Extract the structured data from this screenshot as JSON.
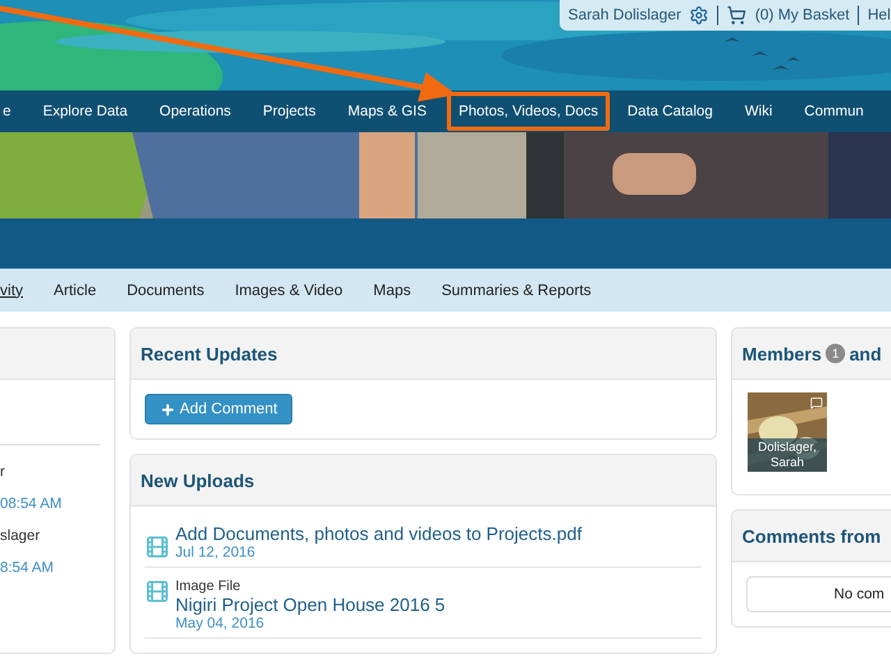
{
  "header": {
    "user_name": "Sarah Dolislager",
    "basket": "(0) My Basket",
    "help": "Hel"
  },
  "nav": [
    {
      "label": "e",
      "highlighted": false
    },
    {
      "label": "Explore Data",
      "highlighted": false
    },
    {
      "label": "Operations",
      "highlighted": false
    },
    {
      "label": "Projects",
      "highlighted": false
    },
    {
      "label": "Maps & GIS",
      "highlighted": false
    },
    {
      "label": "Photos, Videos, Docs",
      "highlighted": true
    },
    {
      "label": "Data Catalog",
      "highlighted": false
    },
    {
      "label": "Wiki",
      "highlighted": false
    },
    {
      "label": "Commun",
      "highlighted": false
    }
  ],
  "tabs": [
    {
      "label": "vity",
      "selected": true
    },
    {
      "label": "Article",
      "selected": false
    },
    {
      "label": "Documents",
      "selected": false
    },
    {
      "label": "Images & Video",
      "selected": false
    },
    {
      "label": "Maps",
      "selected": false
    },
    {
      "label": "Summaries & Reports",
      "selected": false
    }
  ],
  "left_card": {
    "entries": [
      {
        "name": "r",
        "time": "08:54 AM"
      },
      {
        "name": "slager",
        "time": "8:54 AM"
      }
    ]
  },
  "recent_updates": {
    "title": "Recent Updates",
    "button": "Add Comment"
  },
  "new_uploads": {
    "title": "New Uploads",
    "items": [
      {
        "title": "Add Documents, photos and videos to Projects.pdf",
        "date": "Jul 12, 2016"
      },
      {
        "type_label": "Image File",
        "title": "Nigiri Project Open House 2016 5",
        "date": "May 04, 2016"
      }
    ]
  },
  "members": {
    "title": "Members",
    "count": "1",
    "title_rest": "and",
    "people": [
      {
        "name": "Dolislager, Sarah"
      }
    ]
  },
  "comments": {
    "title": "Comments from",
    "empty_text": "No com"
  }
}
